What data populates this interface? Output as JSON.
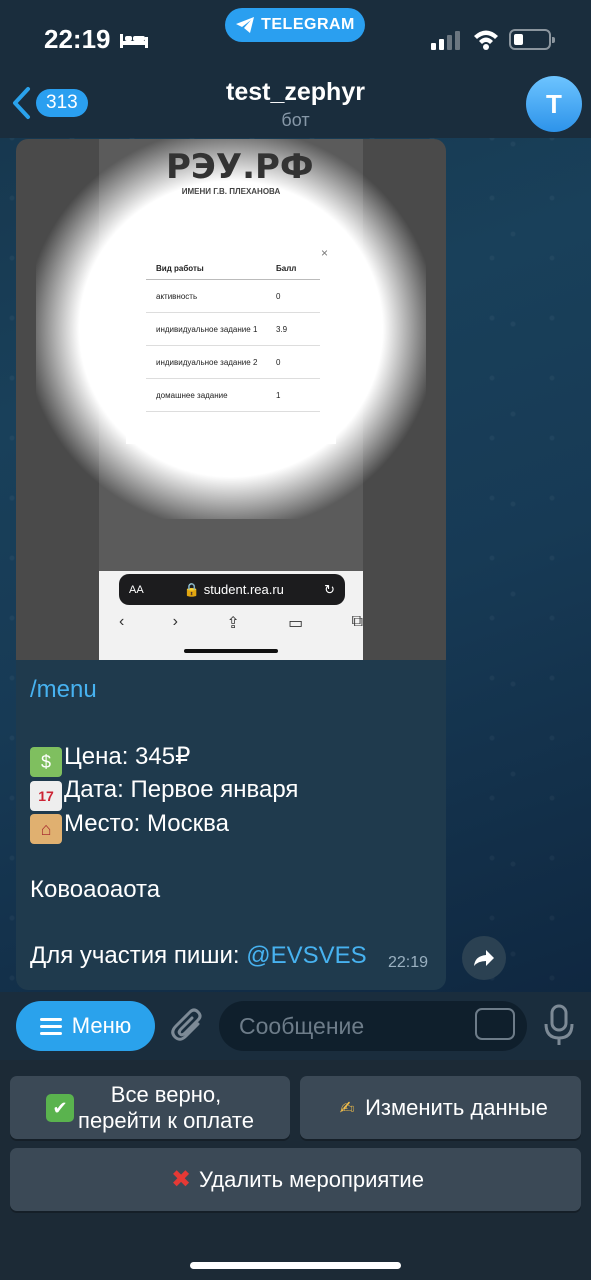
{
  "status_bar": {
    "time": "22:19",
    "app_pill": "TELEGRAM"
  },
  "header": {
    "unread_count": "313",
    "title": "test_zephyr",
    "subtitle": "бот",
    "avatar_letter": "T"
  },
  "photo": {
    "logo": "РЭУ.РФ",
    "logo_sub": "ИМЕНИ Г.В. ПЛЕХАНОВА",
    "table_headers": [
      "Вид работы",
      "Балл"
    ],
    "rows": [
      [
        "активность",
        "0"
      ],
      [
        "индивидуальное задание 1",
        "3.9"
      ],
      [
        "индивидуальное задание 2",
        "0"
      ],
      [
        "домашнее задание",
        "1"
      ]
    ],
    "close": "×",
    "url_aa": "AA",
    "url": "student.rea.ru"
  },
  "message": {
    "command": "/menu",
    "price": "Цена: 345₽",
    "date": "Дата: Первое января",
    "place": "Место: Москва",
    "text": "Ковоаоаота",
    "cta": "Для участия пиши: ",
    "mention": "@EVSVES",
    "time": "22:19",
    "emoji_calendar": "17"
  },
  "input": {
    "menu_label": "Меню",
    "placeholder": "Сообщение"
  },
  "keyboard": {
    "confirm": "Все верно,\nперейти к оплате",
    "edit": "Изменить данные",
    "delete": "Удалить мероприятие"
  },
  "colors": {
    "accent": "#2aa2ec",
    "link": "#47b2f0",
    "bubble": "#1f3a4d",
    "bar": "#1a2d3d"
  }
}
